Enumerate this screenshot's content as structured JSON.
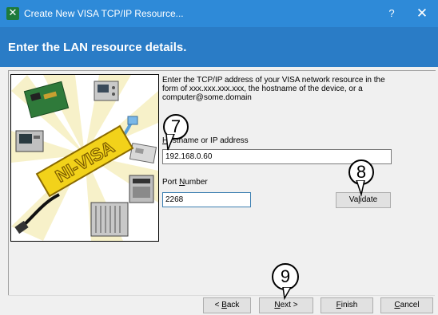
{
  "window": {
    "title": "Create New VISA TCP/IP Resource...",
    "help_label": "?",
    "close_label": "✕",
    "app_icon": "green-x-icon"
  },
  "banner": {
    "title": "Enter the LAN resource details."
  },
  "description": "Enter the TCP/IP address of your VISA network resource in the form of xxx.xxx.xxx.xxx, the hostname of the device, or a computer@some.domain",
  "hostname": {
    "label_hotkey": "H",
    "label_rest": "ostname or IP address",
    "value": "192.168.0.60"
  },
  "port": {
    "label_pre": "Port ",
    "label_hotkey": "N",
    "label_rest": "umber",
    "value": "2268"
  },
  "validate_button": {
    "pre": "Va",
    "hotkey": "l",
    "rest": "idate"
  },
  "buttons": {
    "back": {
      "pre": "< ",
      "hotkey": "B",
      "rest": "ack"
    },
    "next": {
      "hotkey": "N",
      "rest": "ext >"
    },
    "finish": {
      "hotkey": "F",
      "rest": "inish"
    },
    "cancel": {
      "hotkey": "C",
      "rest": "ancel"
    }
  },
  "callouts": {
    "hostname": "7",
    "validate": "8",
    "next": "9"
  },
  "logo_text": "NI-VISA",
  "colors": {
    "titlebar": "#2e8ad8",
    "banner": "#2a7cc6",
    "logo": "#f2d21a",
    "focus_border": "#3c7fb1"
  }
}
